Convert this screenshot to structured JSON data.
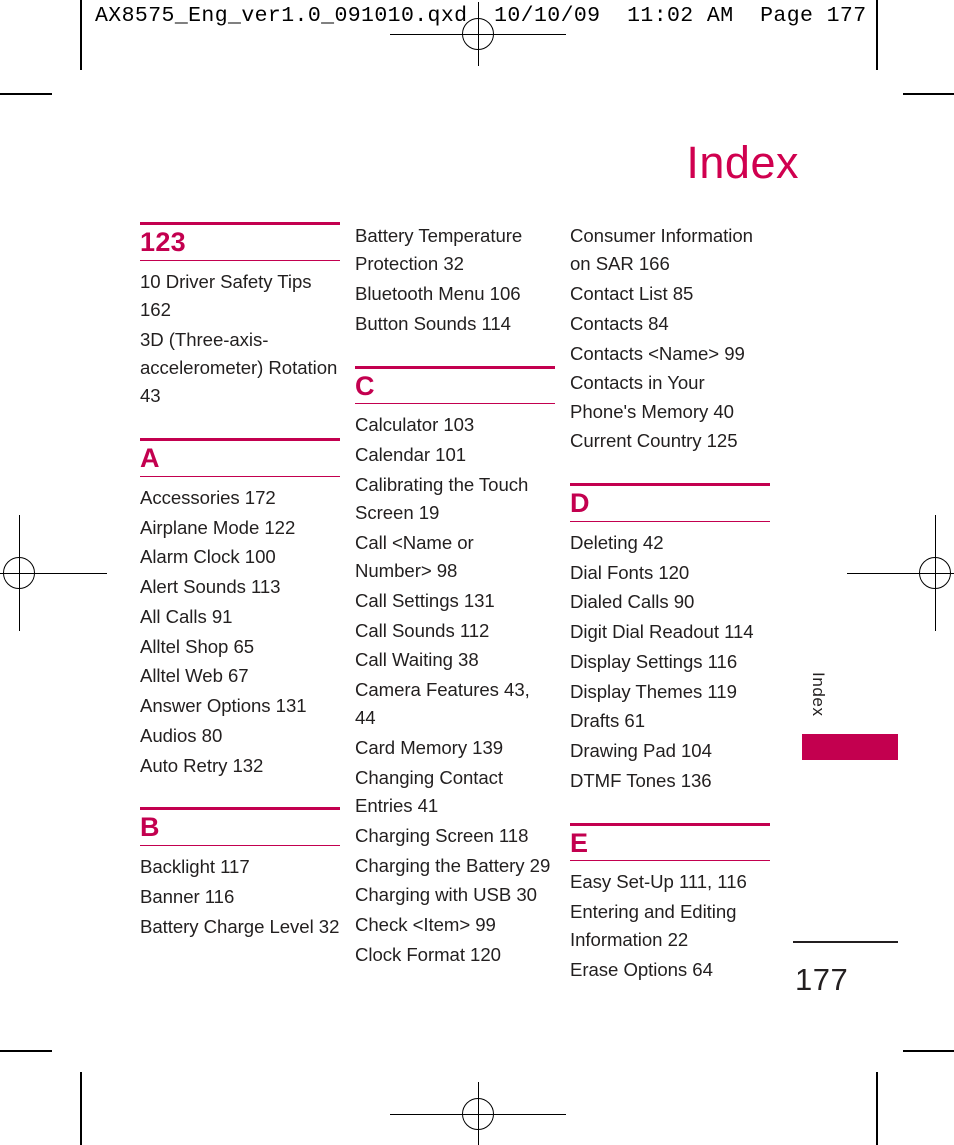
{
  "slug": "AX8575_Eng_ver1.0_091010.qxd  10/10/09  11:02 AM  Page 177",
  "page_title": "Index",
  "side_tab": {
    "label": "Index"
  },
  "folio": "177",
  "colors": {
    "accent": "#c3004f",
    "title": "#d0004f",
    "text": "#221f1f"
  },
  "columns": [
    {
      "sections": [
        {
          "letter": "123",
          "entries": [
            "10 Driver Safety Tips 162",
            "3D (Three-axis-accelerometer) Rotation 43"
          ]
        },
        {
          "letter": "A",
          "entries": [
            "Accessories 172",
            "Airplane Mode 122",
            "Alarm Clock 100",
            "Alert Sounds 113",
            "All Calls 91",
            "Alltel Shop 65",
            "Alltel Web 67",
            "Answer Options 131",
            "Audios 80",
            "Auto Retry 132"
          ]
        },
        {
          "letter": "B",
          "entries": [
            "Backlight 117",
            "Banner 116",
            "Battery Charge Level 32"
          ]
        }
      ]
    },
    {
      "continued": [
        "Battery Temperature Protection 32",
        "Bluetooth Menu 106",
        "Button Sounds 114"
      ],
      "sections": [
        {
          "letter": "C",
          "entries": [
            "Calculator 103",
            "Calendar 101",
            "Calibrating the Touch Screen 19",
            "Call <Name or Number> 98",
            "Call Settings 131",
            "Call Sounds 112",
            "Call Waiting 38",
            "Camera Features 43, 44",
            "Card Memory 139",
            "Changing Contact Entries 41",
            "Charging Screen 118",
            "Charging the Battery 29",
            "Charging with USB 30",
            "Check <Item> 99",
            "Clock Format 120"
          ]
        }
      ]
    },
    {
      "continued": [
        "Consumer Information on SAR 166",
        "Contact List 85",
        "Contacts 84",
        "Contacts <Name> 99",
        "Contacts in Your Phone's Memory 40",
        "Current Country 125"
      ],
      "sections": [
        {
          "letter": "D",
          "entries": [
            "Deleting 42",
            "Dial Fonts 120",
            "Dialed Calls 90",
            "Digit Dial Readout 114",
            "Display Settings 116",
            "Display Themes 119",
            "Drafts 61",
            "Drawing Pad 104",
            "DTMF Tones 136"
          ]
        },
        {
          "letter": "E",
          "entries": [
            "Easy Set-Up 111, 116",
            "Entering and Editing Information 22",
            "Erase Options 64"
          ]
        }
      ]
    }
  ]
}
